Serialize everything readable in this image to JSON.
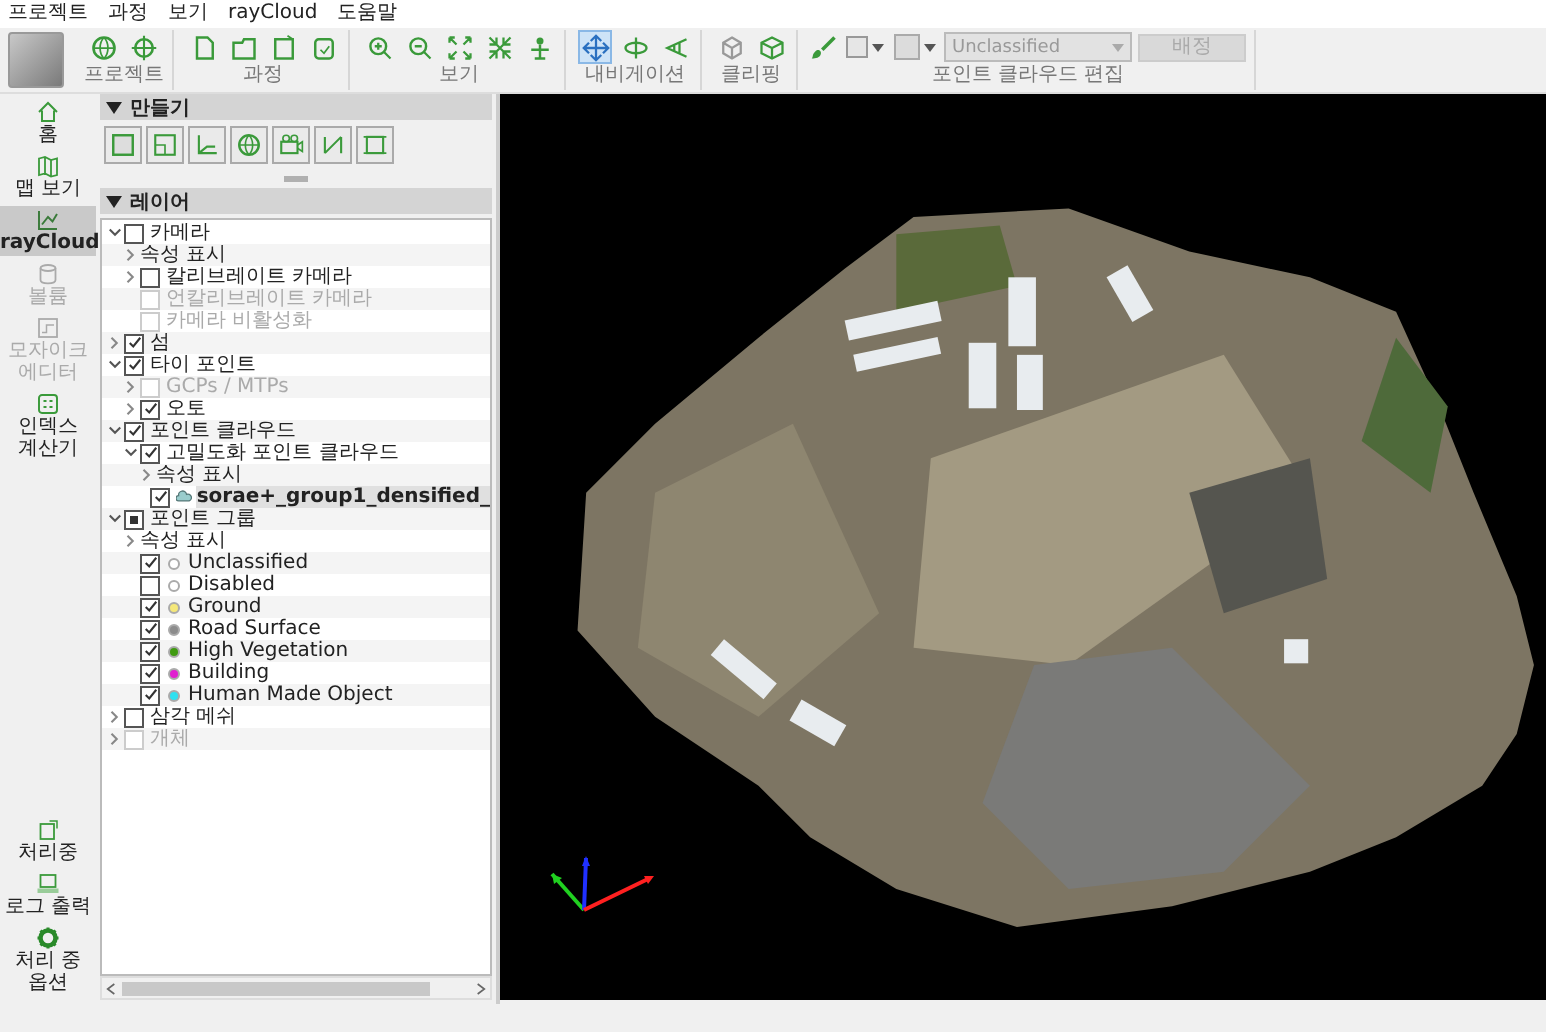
{
  "menu": [
    "프로젝트",
    "과정",
    "보기",
    "rayCloud",
    "도움말"
  ],
  "toolbar": {
    "groups": [
      {
        "label": "프로젝트",
        "tools": [
          {
            "selected": false
          },
          {
            "selected": false
          }
        ]
      },
      {
        "label": "과정",
        "tools": [
          {
            "selected": false
          },
          {
            "selected": false
          },
          {
            "selected": false
          },
          {
            "selected": false
          }
        ]
      },
      {
        "label": "보기",
        "tools": [
          {
            "selected": false
          },
          {
            "selected": false
          },
          {
            "selected": false
          },
          {
            "selected": false
          },
          {
            "selected": false
          }
        ]
      },
      {
        "label": "내비게이션",
        "tools": [
          {
            "selected": true
          },
          {
            "selected": false
          },
          {
            "selected": false
          }
        ]
      },
      {
        "label": "클리핑",
        "tools": [
          {
            "selected": false
          },
          {
            "selected": false
          }
        ]
      }
    ],
    "edit": {
      "label": "포인트 클라우드 편집",
      "class_select": {
        "value": "Unclassified",
        "disabled": true
      },
      "assign_button": {
        "label": "배정",
        "disabled": true
      }
    }
  },
  "sidebar": {
    "items": [
      {
        "label": "홈",
        "selected": false,
        "disabled": false
      },
      {
        "label": "맵 보기",
        "selected": false,
        "disabled": false
      },
      {
        "label": "rayCloud",
        "selected": true,
        "disabled": false
      },
      {
        "label": "볼륨",
        "selected": false,
        "disabled": true
      },
      {
        "label": "모자이크 에디터",
        "selected": false,
        "disabled": true
      },
      {
        "label": "인덱스 계산기",
        "selected": false,
        "disabled": false
      }
    ],
    "bottom_items": [
      {
        "label": "처리중"
      },
      {
        "label": "로그 출력"
      },
      {
        "label": "처리 중 옵션"
      }
    ]
  },
  "create_section": {
    "title": "만들기",
    "expanded": true,
    "tools": [
      {
        "selected": false
      },
      {
        "selected": false
      },
      {
        "selected": false
      },
      {
        "selected": false
      },
      {
        "selected": false
      },
      {
        "selected": false
      },
      {
        "selected": false
      }
    ]
  },
  "layers_section": {
    "title": "레이어",
    "expanded": true,
    "tree": [
      {
        "label": "카메라",
        "expanded": true,
        "checked": false,
        "selected": false,
        "children": [
          {
            "label": "속성 표시",
            "expanded": false,
            "selected": false
          },
          {
            "label": "칼리브레이트 카메라",
            "expanded": false,
            "checked": false,
            "selected": false
          },
          {
            "label": "언칼리브레이트 카메라",
            "checked": false,
            "disabled": true,
            "selected": false
          },
          {
            "label": "카메라 비활성화",
            "checked": false,
            "disabled": true,
            "selected": false
          }
        ]
      },
      {
        "label": "섬",
        "expanded": false,
        "checked": true,
        "selected": false
      },
      {
        "label": "타이 포인트",
        "expanded": true,
        "checked": true,
        "selected": false,
        "children": [
          {
            "label": "GCPs / MTPs",
            "expanded": false,
            "checked": false,
            "disabled": true,
            "selected": false
          },
          {
            "label": "오토",
            "expanded": false,
            "checked": true,
            "selected": false
          }
        ]
      },
      {
        "label": "포인트 클라우드",
        "expanded": true,
        "checked": true,
        "selected": false,
        "children": [
          {
            "label": "고밀도화 포인트 클라우드",
            "expanded": true,
            "checked": true,
            "selected": false,
            "children": [
              {
                "label": "속성 표시",
                "expanded": false,
                "selected": false
              },
              {
                "label": "sorae+_group1_densified_",
                "kind": "cloud",
                "checked": true,
                "selected": true
              }
            ]
          }
        ]
      },
      {
        "label": "포인트 그룹",
        "expanded": true,
        "checked": true,
        "partial": true,
        "selected": false,
        "children": [
          {
            "label": "속성 표시",
            "expanded": false,
            "selected": false
          },
          {
            "label": "Unclassified",
            "kind": "class",
            "checked": true,
            "color": "#ffffff",
            "selected": false
          },
          {
            "label": "Disabled",
            "kind": "class",
            "checked": false,
            "color": "#ffffff",
            "selected": false
          },
          {
            "label": "Ground",
            "kind": "class",
            "checked": true,
            "color": "#f5e87a",
            "selected": false
          },
          {
            "label": "Road Surface",
            "kind": "class",
            "checked": true,
            "color": "#8c8c8c",
            "selected": false
          },
          {
            "label": "High Vegetation",
            "kind": "class",
            "checked": true,
            "color": "#3f9a10",
            "selected": false
          },
          {
            "label": "Building",
            "kind": "class",
            "checked": true,
            "color": "#e020d0",
            "selected": false
          },
          {
            "label": "Human Made Object",
            "kind": "class",
            "checked": true,
            "color": "#30e0f0",
            "selected": false
          }
        ]
      },
      {
        "label": "삼각 메쉬",
        "expanded": false,
        "checked": false,
        "selected": false
      },
      {
        "label": "개체",
        "expanded": false,
        "checked": false,
        "disabled": true,
        "selected": false
      }
    ]
  }
}
